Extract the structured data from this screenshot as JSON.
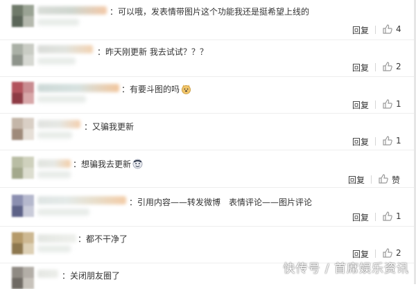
{
  "comments": [
    {
      "text": "：可以哦，发表情带图片这个功能我还是挺希望上线的",
      "reply": "回复",
      "likes": "4"
    },
    {
      "text": "：昨天刚更新 我去试试？？？",
      "reply": "回复",
      "likes": "2"
    },
    {
      "text": "：有要斗图的吗",
      "reply": "回复",
      "likes": "1",
      "emoji": "doge-emoji"
    },
    {
      "text": "：又骗我更新",
      "reply": "回复",
      "likes": "1"
    },
    {
      "text": "：想骗我去更新",
      "reply": "回复",
      "likes": "赞",
      "emoji": "mask-face-emoji"
    },
    {
      "text": "：引用内容——转发微博　表情评论——图片评论",
      "reply": "回复",
      "likes": "1"
    },
    {
      "text": "：都不干净了",
      "reply": "回复",
      "likes": "2"
    },
    {
      "text": "：关闭朋友圈了"
    }
  ],
  "watermark": "快传号 / 首席娱乐资讯",
  "colors": {
    "text": "#333333",
    "divider": "#eeeeee",
    "icon": "#999999"
  }
}
